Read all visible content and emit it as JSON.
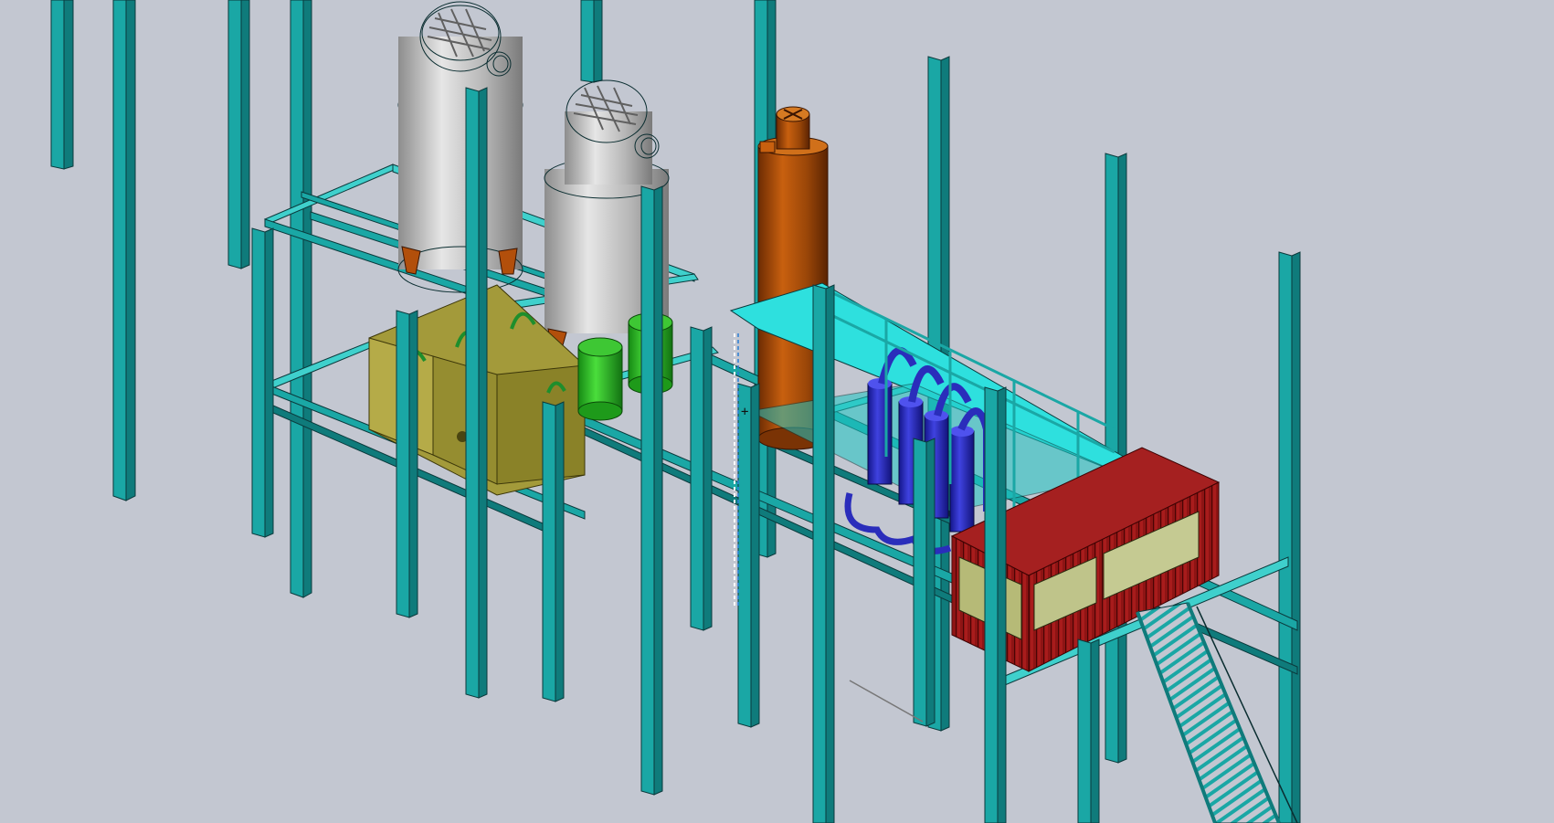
{
  "viewport": {
    "label": "cad-3d-viewport",
    "background_color": "#c3c7d1"
  },
  "colors": {
    "steel": "#1aa7a5",
    "steel_dark": "#0f7b7b",
    "steel_light": "#3fd0cc",
    "silo": "#b8b8b8",
    "silo_light": "#dcdcdc",
    "column_orange": "#b24f0b",
    "filter_green": "#2fb52a",
    "hopper_olive": "#a39a3a",
    "pipes_blue": "#2a2dbb",
    "container_red": "#8e1414",
    "deck_cyan": "#2ee0de"
  },
  "components": [
    {
      "name": "steel-structure-frame"
    },
    {
      "name": "silo-left"
    },
    {
      "name": "silo-right"
    },
    {
      "name": "distillation-column"
    },
    {
      "name": "green-filter-left"
    },
    {
      "name": "green-filter-right"
    },
    {
      "name": "olive-hopper-unit"
    },
    {
      "name": "blue-vessel-array"
    },
    {
      "name": "red-control-container"
    },
    {
      "name": "access-staircase"
    },
    {
      "name": "platform-railing"
    }
  ]
}
